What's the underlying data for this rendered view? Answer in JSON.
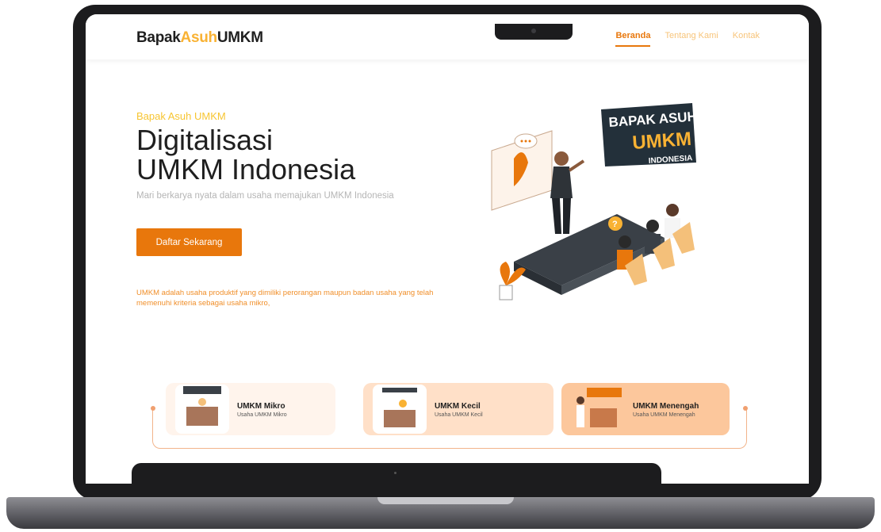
{
  "header": {
    "logo_part1": "Bapak",
    "logo_part2": "Asuh",
    "logo_part3": "UMKM",
    "nav": [
      {
        "label": "Beranda",
        "active": true
      },
      {
        "label": "Tentang Kami",
        "active": false
      },
      {
        "label": "Kontak",
        "active": false
      }
    ]
  },
  "hero": {
    "eyebrow": "Bapak Asuh UMKM",
    "title_line1": "Digitalisasi",
    "title_line2": "UMKM Indonesia",
    "subtitle": "Mari berkarya nyata dalam usaha memajukan UMKM Indonesia",
    "cta_label": "Daftar Sekarang",
    "description": "UMKM adalah usaha produktif yang dimiliki perorangan maupun badan usaha yang telah memenuhi kriteria sebagai usaha mikro,"
  },
  "illustration": {
    "badge_line1": "BAPAK ASUH",
    "badge_line2": "UMKM",
    "badge_line3": "INDONESIA"
  },
  "categories": [
    {
      "title": "UMKM Mikro",
      "subtitle": "Usaha UMKM Mikro"
    },
    {
      "title": "UMKM Kecil",
      "subtitle": "Usaha UMKM Kecil"
    },
    {
      "title": "UMKM Menengah",
      "subtitle": "Usaha UMKM Menengah"
    }
  ],
  "colors": {
    "primary": "#e8770c",
    "accent_yellow": "#f7c531",
    "text_dark": "#1f1f1f",
    "nav_inactive": "#f7c47a"
  }
}
